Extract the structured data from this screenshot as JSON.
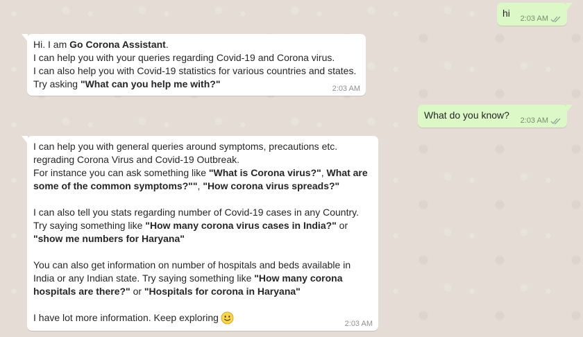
{
  "messages": {
    "m1": {
      "text": "hi",
      "time": "2:03 AM"
    },
    "m2": {
      "l1_pre": "Hi. I am ",
      "l1_bold": "Go Corona Assistant",
      "l1_post": ".",
      "l2": "I can help you with your queries regarding Covid-19 and Corona virus.",
      "l3": "I can also help you with Covid-19 statistics for various countries and states.",
      "l4_pre": "Try asking ",
      "l4_bold": "\"What can you help me with?\"",
      "time": "2:03 AM"
    },
    "m3": {
      "text": "What do you know?",
      "time": "2:03 AM"
    },
    "m4": {
      "p1_l1": "I can help you with general queries around symptoms, precautions etc.",
      "p1_l2": "regrading Corona Virus and Covid-19 Outbreak.",
      "p1_l3_pre": "For instance you can ask something like ",
      "p1_l3_b1": "\"What is Corona virus?\"",
      "p1_l3_sep": ", ",
      "p1_l3_b2": "What are",
      "p1_l4_b": "some of the common symptoms?\"\"",
      "p1_l4_sep": ", ",
      "p1_l4_b2": "\"How corona virus spreads?\"",
      "p2_l1": "I can also tell you stats regarding number of Covid-19 cases in any Country.",
      "p2_l2_pre": "Try saying something like ",
      "p2_l2_b": "\"How many corona virus cases in India?\"",
      "p2_l2_post": " or",
      "p2_l3_b": "\"show me numbers for Haryana\"",
      "p3_l1": "You can also get information on number of hospitals and beds available in",
      "p3_l2_pre": "India or any Indian state. Try saying something like ",
      "p3_l2_b": "\"How many corona",
      "p3_l3_b": "hospitals are there?\"",
      "p3_l3_mid": " or ",
      "p3_l3_b2": "\"Hospitals for corona in Haryana\"",
      "p4": "I have lot more information. Keep exploring",
      "emoji": "smiling-face",
      "time": "2:03 AM"
    }
  },
  "colors": {
    "background": "#e5ddd5",
    "outgoing_bubble": "#dcf8c6",
    "incoming_bubble": "#ffffff",
    "read_ticks": "#8fa39a"
  }
}
